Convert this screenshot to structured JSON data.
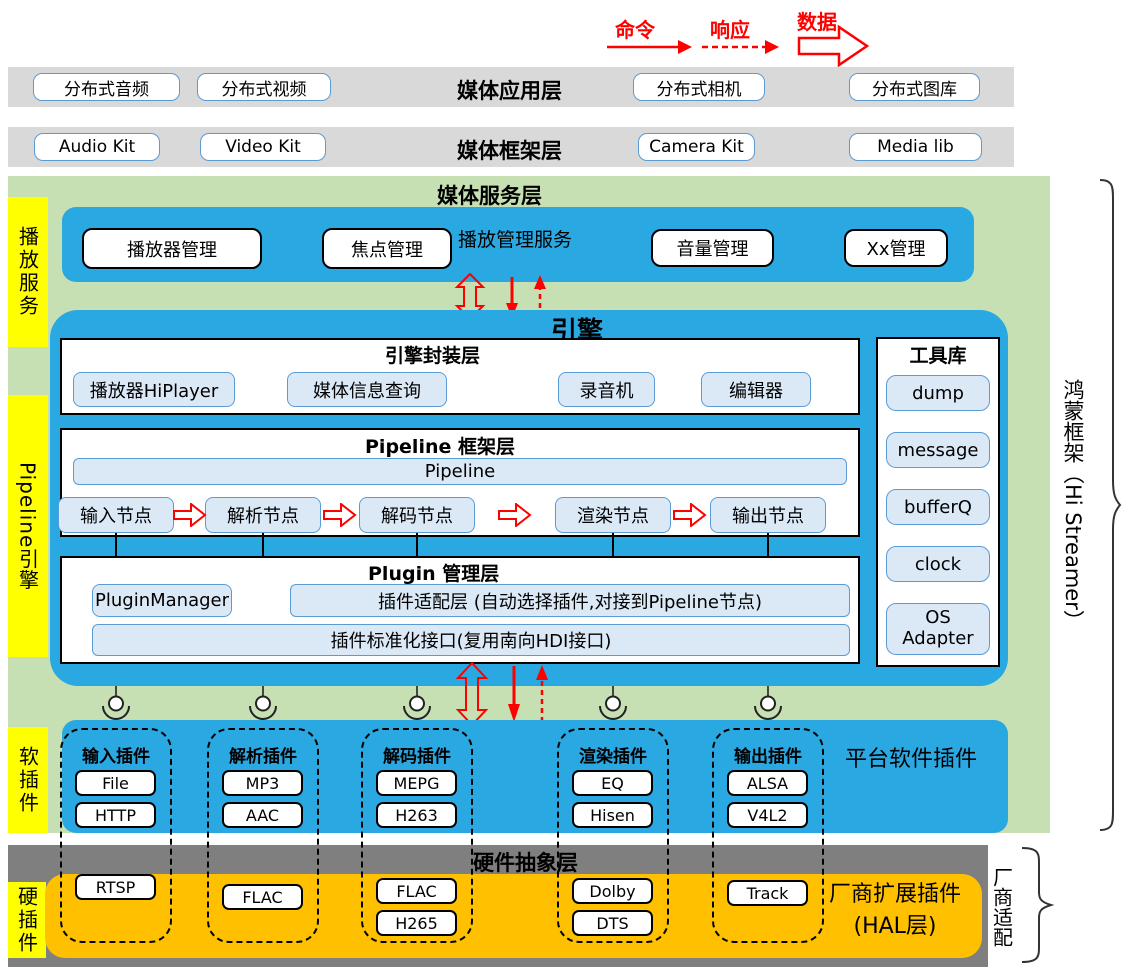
{
  "legend": {
    "command": "命令",
    "response": "响应",
    "data": "数据"
  },
  "app_layer": {
    "title": "媒体应用层",
    "items": [
      "分布式音频",
      "分布式视频",
      "分布式相机",
      "分布式图库"
    ]
  },
  "framework_layer": {
    "title": "媒体框架层",
    "items": [
      "Audio Kit",
      "Video Kit",
      "Camera Kit",
      "Media lib"
    ]
  },
  "service_layer": {
    "title": "媒体服务层"
  },
  "playback": {
    "side_label": "播放服务",
    "bar_label": "播放管理服务",
    "items": [
      "播放器管理",
      "焦点管理",
      "音量管理",
      "Xx管理"
    ]
  },
  "engine": {
    "title": "引擎",
    "side_label": "Pipeline引擎",
    "wrapper": {
      "title": "引擎封装层",
      "items": [
        "播放器HiPlayer",
        "媒体信息查询",
        "录音机",
        "编辑器"
      ]
    },
    "pipeline": {
      "title": "Pipeline 框架层",
      "bar": "Pipeline",
      "nodes": [
        "输入节点",
        "解析节点",
        "解码节点",
        "渲染节点",
        "输出节点"
      ]
    },
    "plugin_mgmt": {
      "title": "Plugin 管理层",
      "manager": "PluginManager",
      "adapter": "插件适配层 (自动选择插件,对接到Pipeline节点)",
      "standard": "插件标准化接口(复用南向HDI接口)"
    },
    "toolbox": {
      "title": "工具库",
      "items": [
        "dump",
        "message",
        "bufferQ",
        "clock",
        "OS Adapter"
      ]
    }
  },
  "plugins": {
    "side_label": "软插件",
    "bar_label": "平台软件插件",
    "groups": [
      {
        "title": "输入插件",
        "soft": [
          "File",
          "HTTP"
        ],
        "hal": [
          "RTSP"
        ]
      },
      {
        "title": "解析插件",
        "soft": [
          "MP3",
          "AAC"
        ],
        "hal": [
          "FLAC"
        ]
      },
      {
        "title": "解码插件",
        "soft": [
          "MEPG",
          "H263"
        ],
        "hal": [
          "FLAC",
          "H265"
        ]
      },
      {
        "title": "渲染插件",
        "soft": [
          "EQ",
          "Hisen"
        ],
        "hal": [
          "Dolby",
          "DTS"
        ]
      },
      {
        "title": "输出插件",
        "soft": [
          "ALSA",
          "V4L2"
        ],
        "hal": [
          "Track"
        ]
      }
    ]
  },
  "hal": {
    "title": "硬件抽象层",
    "side_label": "硬插件",
    "bar_label_line1": "厂商扩展插件",
    "bar_label_line2": "(HAL层)"
  },
  "brackets": {
    "framework": "鸿蒙框架（Hi Streamer）",
    "vendor": "厂商适配"
  },
  "colors": {
    "blue": "#29a8e2",
    "green": "#c6e0b4",
    "gray_light": "#d9d9d9",
    "gray_dark": "#7f7f7f",
    "orange": "#ffc000",
    "yellow": "#ffff00",
    "red": "#ff0000",
    "box_fill": "#dbe9f7",
    "box_border": "#5b9bd5"
  }
}
